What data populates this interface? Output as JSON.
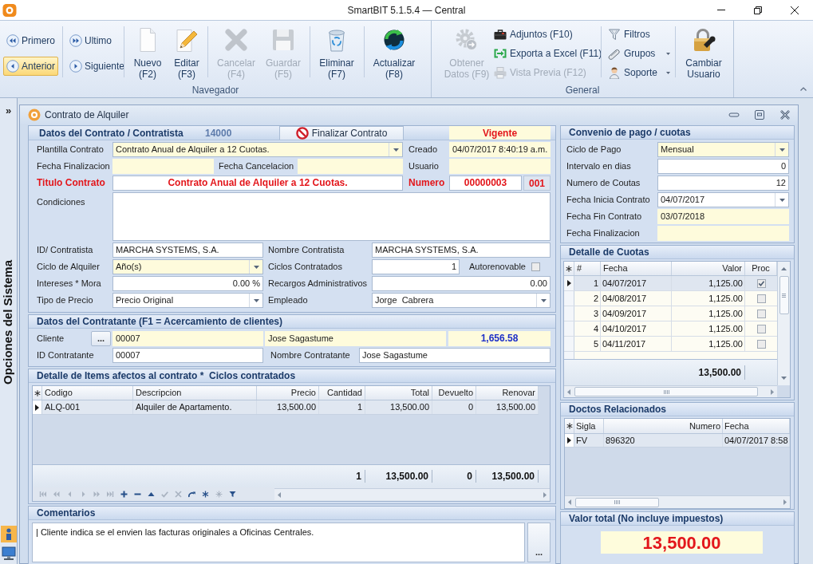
{
  "window": {
    "title": "SmartBIT 5.1.5.4 — Central"
  },
  "ribbon": {
    "navigator": {
      "label": "Navegador",
      "nav_buttons": [
        {
          "label": "Primero",
          "highlighted": false
        },
        {
          "label": "Anterior",
          "highlighted": true
        },
        {
          "label": "Ultimo",
          "highlighted": false
        },
        {
          "label": "Siguiente",
          "highlighted": false
        }
      ],
      "buttons": [
        {
          "lines": [
            "Nuevo",
            "(F2)"
          ],
          "disabled": false
        },
        {
          "lines": [
            "Editar",
            "(F3)"
          ],
          "disabled": false
        },
        {
          "lines": [
            "Cancelar",
            "(F4)"
          ],
          "disabled": true
        },
        {
          "lines": [
            "Guardar",
            "(F5)"
          ],
          "disabled": true
        },
        {
          "lines": [
            "Eliminar",
            "(F7)"
          ],
          "disabled": false
        },
        {
          "lines": [
            "Actualizar",
            "(F8)"
          ],
          "disabled": false
        }
      ]
    },
    "general": {
      "label": "General",
      "button": {
        "lines": [
          "Obtener",
          "Datos (F9)"
        ],
        "disabled": true
      },
      "actions": [
        {
          "label": "Adjuntos (F10)",
          "disabled": false
        },
        {
          "label": "Exporta a Excel (F11)",
          "disabled": false
        },
        {
          "label": "Vista Previa (F12)",
          "disabled": true
        }
      ],
      "menus": [
        {
          "label": "Filtros",
          "dropdown": false
        },
        {
          "label": "Grupos",
          "dropdown": true
        },
        {
          "label": "Soporte",
          "dropdown": true
        }
      ],
      "user_button": {
        "lines": [
          "Cambiar",
          "Usuario"
        ]
      }
    }
  },
  "sidebar": {
    "toggle": "»",
    "title": "Opciones del Sistema"
  },
  "form": {
    "title": "Contrato de Alquiler",
    "contract": {
      "title": "Datos del Contrato / Contratista",
      "code": "14000",
      "finish_button": "Finalizar Contrato",
      "status": "Vigente",
      "template": {
        "label": "Plantilla Contrato",
        "kind": "combo",
        "shaded": true,
        "value": "Contrato Anual de Alquiler a 12 Cuotas."
      },
      "created": {
        "label": "Creado",
        "kind": "text",
        "shaded": true,
        "value": "04/07/2017 8:40:19 a.m."
      },
      "finish_date": {
        "label": "Fecha Finalizacion",
        "kind": "text",
        "shaded": true
      },
      "cancel_date": {
        "label": "Fecha Cancelacion",
        "kind": "text",
        "shaded": true
      },
      "user": {
        "label": "Usuario",
        "kind": "text",
        "shaded": true
      },
      "contract_title": {
        "label": "Titulo Contrato",
        "kind": "text",
        "shaded": false,
        "value": "Contrato Anual de Alquiler a 12 Cuotas."
      },
      "number": {
        "label": "Numero",
        "kind": "text",
        "shaded": false,
        "value": "00000003",
        "suffix": "001"
      },
      "conditions": {
        "label": "Condiciones",
        "kind": "memo",
        "shaded": false
      },
      "contractor_id": {
        "label": "ID/ Contratista",
        "kind": "text",
        "shaded": false,
        "value": "MARCHA SYSTEMS, S.A."
      },
      "contractor_name": {
        "label": "Nombre Contratista",
        "kind": "text",
        "shaded": false,
        "value": "MARCHA SYSTEMS, S.A."
      },
      "rental_cycle": {
        "label": "Ciclo de Alquiler",
        "kind": "combo",
        "shaded": true,
        "value": "Año(s)"
      },
      "cycles": {
        "label": "Ciclos Contratados",
        "kind": "number",
        "shaded": false,
        "value": "1"
      },
      "auto_renew": {
        "label": "Autorenovable",
        "checked": false
      },
      "interest": {
        "label": "Intereses * Mora",
        "kind": "number",
        "shaded": false,
        "value": "0.00 %"
      },
      "admin_charges": {
        "label": "Recargos Administrativos",
        "kind": "number",
        "shaded": false,
        "value": "0.00"
      },
      "price_type": {
        "label": "Tipo de Precio",
        "kind": "combo",
        "shaded": false,
        "value": "Precio Original"
      },
      "employee": {
        "label": "Empleado",
        "kind": "combo",
        "shaded": false,
        "value": "Jorge  Cabrera"
      }
    },
    "contractor": {
      "title": "Datos del Contratante (F1 = Acercamiento de clientes)",
      "client": {
        "label": "Cliente",
        "button": "...",
        "code": {
          "kind": "text",
          "shaded": true,
          "value": "00007"
        },
        "name": {
          "kind": "text",
          "shaded": true,
          "value": "Jose Sagastume"
        },
        "balance": {
          "kind": "text",
          "shaded": true,
          "value": "1,656.58"
        }
      },
      "id": {
        "label": "ID Contratante",
        "kind": "text",
        "shaded": false,
        "value": "00007"
      },
      "name": {
        "label": "Nombre Contratante",
        "kind": "text",
        "shaded": false,
        "value": "Jose Sagastume"
      }
    },
    "items": {
      "title": "Detalle de Items afectos al contrato *  Ciclos contratados",
      "columns": [
        "Codigo",
        "Descripcion",
        "Precio",
        "Cantidad",
        "Total",
        "Devuelto",
        "Renovar"
      ],
      "rows": [
        {
          "selected": true,
          "cells": [
            "ALQ-001",
            "Alquiler de Apartamento.",
            "13,500.00",
            "1",
            "13,500.00",
            "0",
            "13,500.00"
          ]
        }
      ],
      "totals": [
        "1",
        "13,500.00",
        "0",
        "13,500.00"
      ],
      "navigator": [
        {
          "disabled": true
        },
        {
          "disabled": true
        },
        {
          "disabled": true
        },
        {
          "disabled": true
        },
        {
          "disabled": true
        },
        {
          "disabled": true
        },
        {
          "disabled": false
        },
        {
          "disabled": false
        },
        {
          "disabled": false
        },
        {
          "disabled": true
        },
        {
          "disabled": true
        },
        {
          "disabled": false
        },
        {
          "disabled": false
        },
        {
          "disabled": true
        },
        {
          "disabled": false
        }
      ]
    },
    "comments": {
      "title": "Comentarios",
      "text": "| Cliente indica se el envien las facturas originales a Oficinas Centrales.",
      "button": "..."
    },
    "payment": {
      "title": "Convenio de pago / cuotas",
      "fields": [
        {
          "label": "Ciclo de Pago",
          "kind": "combo",
          "shaded": true,
          "value": "Mensual"
        },
        {
          "label": "Intervalo en dias",
          "kind": "number",
          "shaded": false,
          "value": "0"
        },
        {
          "label": "Numero de Coutas",
          "kind": "number",
          "shaded": false,
          "value": "12"
        },
        {
          "label": "Fecha Inicia Contrato",
          "kind": "combo",
          "shaded": false,
          "value": "04/07/2017"
        },
        {
          "label": "Fecha Fin Contrato",
          "kind": "text",
          "shaded": true,
          "value": "03/07/2018"
        },
        {
          "label": "Fecha Finalizacion",
          "kind": "text",
          "shaded": true
        }
      ]
    },
    "installments": {
      "title": "Detalle de Cuotas",
      "columns": [
        "#",
        "Fecha",
        "Valor",
        "Proc"
      ],
      "rows": [
        {
          "selected": true,
          "checked": true,
          "cells": [
            "1",
            "04/07/2017",
            "1,125.00"
          ]
        },
        {
          "selected": false,
          "checked": false,
          "cells": [
            "2",
            "04/08/2017",
            "1,125.00"
          ]
        },
        {
          "selected": false,
          "checked": false,
          "cells": [
            "3",
            "04/09/2017",
            "1,125.00"
          ]
        },
        {
          "selected": false,
          "checked": false,
          "cells": [
            "4",
            "04/10/2017",
            "1,125.00"
          ]
        },
        {
          "selected": false,
          "checked": false,
          "cells": [
            "5",
            "04/11/2017",
            "1,125.00"
          ]
        }
      ],
      "total": "13,500.00"
    },
    "documents": {
      "title": "Doctos Relacionados",
      "columns": [
        "Sigla",
        "Numero",
        "Fecha"
      ],
      "rows": [
        {
          "selected": true,
          "cells": [
            "FV",
            "896320",
            "04/07/2017 8:58"
          ]
        }
      ]
    },
    "total": {
      "title": "Valor total (No incluye impuestos)",
      "value": "13,500.00"
    }
  }
}
